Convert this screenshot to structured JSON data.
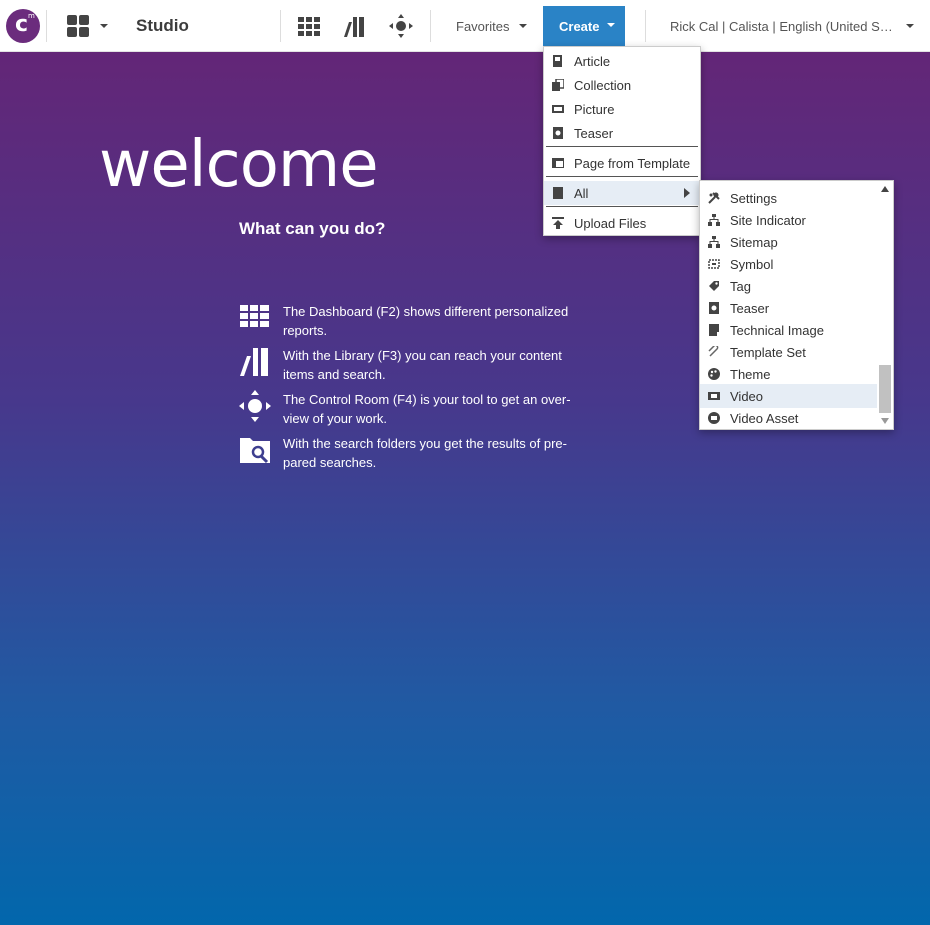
{
  "topbar": {
    "logo_letter": "c",
    "logo_sup": "m",
    "app_title": "Studio",
    "favorites_label": "Favorites",
    "create_label": "Create",
    "user_label": "Rick Cal | Calista | English (United States)"
  },
  "welcome": {
    "heading": "welcome",
    "question": "What can you do?",
    "items": [
      {
        "icon": "dashboard-icon",
        "text": "The Dashboard (F2) shows different personalized reports."
      },
      {
        "icon": "library-icon",
        "text": "With the Library (F3) you can reach your content items and search."
      },
      {
        "icon": "control-room-icon",
        "text": "The Control Room (F4) is your tool to get an over-view of your work."
      },
      {
        "icon": "search-folder-icon",
        "text": "With the search folders you get the results of pre-pared searches."
      }
    ]
  },
  "create_menu": {
    "items": [
      {
        "label": "Article",
        "icon": "article-icon"
      },
      {
        "label": "Collection",
        "icon": "collection-icon"
      },
      {
        "label": "Picture",
        "icon": "picture-icon"
      },
      {
        "label": "Teaser",
        "icon": "teaser-icon"
      },
      {
        "label": "Page from Template",
        "icon": "page-template-icon"
      },
      {
        "label": "All",
        "icon": "all-icon"
      },
      {
        "label": "Upload Files",
        "icon": "upload-icon"
      }
    ]
  },
  "all_submenu": {
    "items": [
      {
        "label": "Settings",
        "icon": "settings-icon"
      },
      {
        "label": "Site Indicator",
        "icon": "site-indicator-icon"
      },
      {
        "label": "Sitemap",
        "icon": "sitemap-icon"
      },
      {
        "label": "Symbol",
        "icon": "symbol-icon"
      },
      {
        "label": "Tag",
        "icon": "tag-icon"
      },
      {
        "label": "Teaser",
        "icon": "teaser-icon"
      },
      {
        "label": "Technical Image",
        "icon": "technical-image-icon"
      },
      {
        "label": "Template Set",
        "icon": "template-set-icon"
      },
      {
        "label": "Theme",
        "icon": "theme-icon"
      },
      {
        "label": "Video",
        "icon": "video-icon"
      },
      {
        "label": "Video Asset",
        "icon": "video-asset-icon"
      }
    ],
    "selected": "Video"
  },
  "colors": {
    "brand": "#6b2c7d",
    "create_button": "#2a83c6",
    "gradient_top": "#632677",
    "gradient_bottom": "#0267ac",
    "selected_item": "#e6edf5"
  }
}
